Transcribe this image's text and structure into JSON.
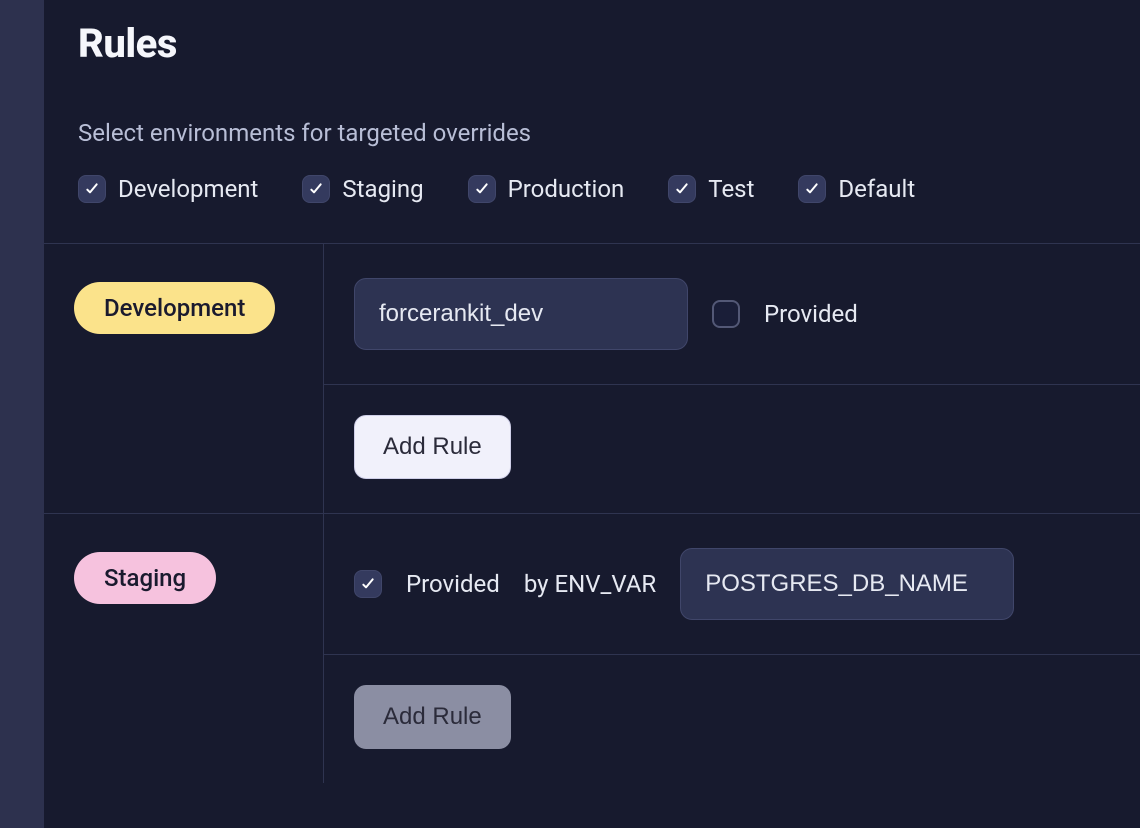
{
  "header": {
    "title": "Rules",
    "subtitle": "Select environments for targeted overrides"
  },
  "env_checkboxes": [
    {
      "label": "Development",
      "checked": true
    },
    {
      "label": "Staging",
      "checked": true
    },
    {
      "label": "Production",
      "checked": true
    },
    {
      "label": "Test",
      "checked": true
    },
    {
      "label": "Default",
      "checked": true
    }
  ],
  "rows": {
    "development": {
      "pill_label": "Development",
      "value_input": "forcerankit_dev",
      "provided_checked": false,
      "provided_label": "Provided",
      "add_rule_label": "Add Rule"
    },
    "staging": {
      "pill_label": "Staging",
      "provided_checked": true,
      "provided_label": "Provided",
      "by_label": "by ENV_VAR",
      "env_var_value": "POSTGRES_DB_NAME",
      "add_rule_label": "Add Rule"
    }
  }
}
